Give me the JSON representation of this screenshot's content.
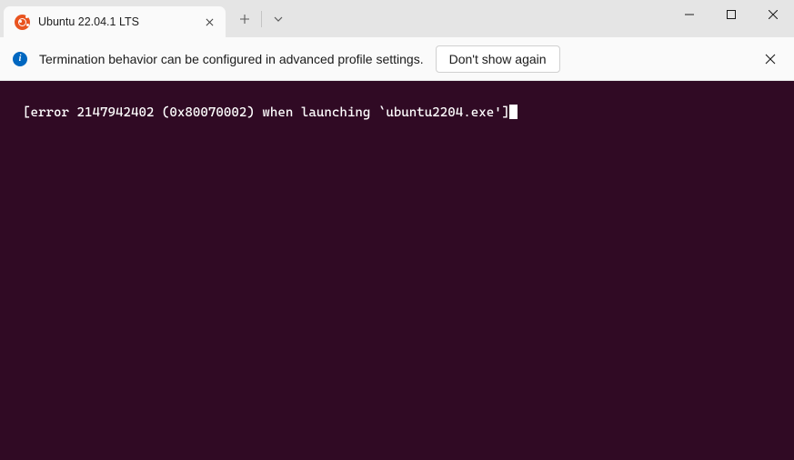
{
  "titlebar": {
    "tab": {
      "title": "Ubuntu 22.04.1 LTS"
    }
  },
  "infobar": {
    "message": "Termination behavior can be configured in advanced profile settings.",
    "button_label": "Don't show again"
  },
  "terminal": {
    "line": "[error 2147942402 (0x80070002) when launching `ubuntu2204.exe']"
  },
  "colors": {
    "terminal_bg": "#300a24",
    "ubuntu_orange": "#e95420",
    "info_blue": "#0067c0"
  }
}
